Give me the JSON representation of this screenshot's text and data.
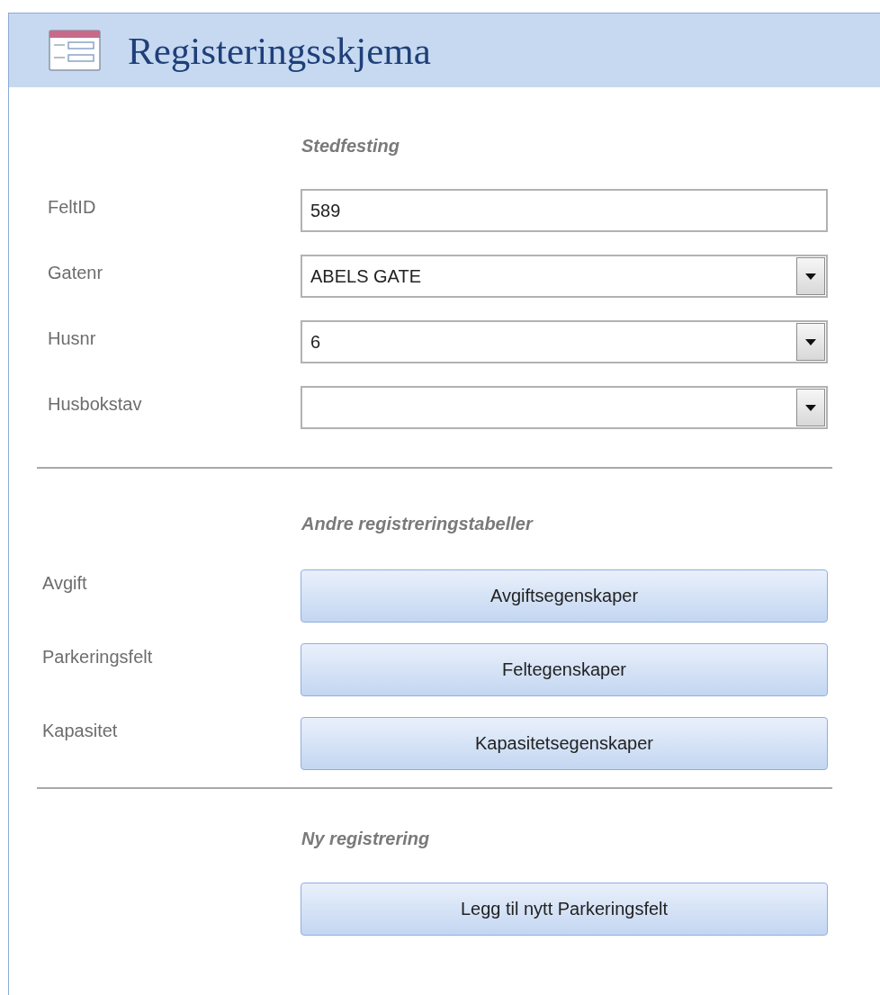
{
  "header": {
    "title": "Registeringsskjema"
  },
  "location": {
    "heading": "Stedfesting",
    "fields": [
      {
        "label": "FeltID",
        "value": "589",
        "kind": "text"
      },
      {
        "label": "Gatenr",
        "value": "ABELS GATE",
        "kind": "combo"
      },
      {
        "label": "Husnr",
        "value": "6",
        "kind": "combo"
      },
      {
        "label": "Husbokstav",
        "kind": "combo"
      }
    ]
  },
  "other_tables": {
    "heading": "Andre registreringstabeller",
    "rows": [
      {
        "label": "Avgift",
        "button": "Avgiftsegenskaper"
      },
      {
        "label": "Parkeringsfelt",
        "button": "Feltegenskaper"
      },
      {
        "label": "Kapasitet",
        "button": "Kapasitetsegenskaper"
      }
    ]
  },
  "new_registration": {
    "heading": "Ny registrering",
    "button": "Legg til nytt Parkeringsfelt"
  }
}
